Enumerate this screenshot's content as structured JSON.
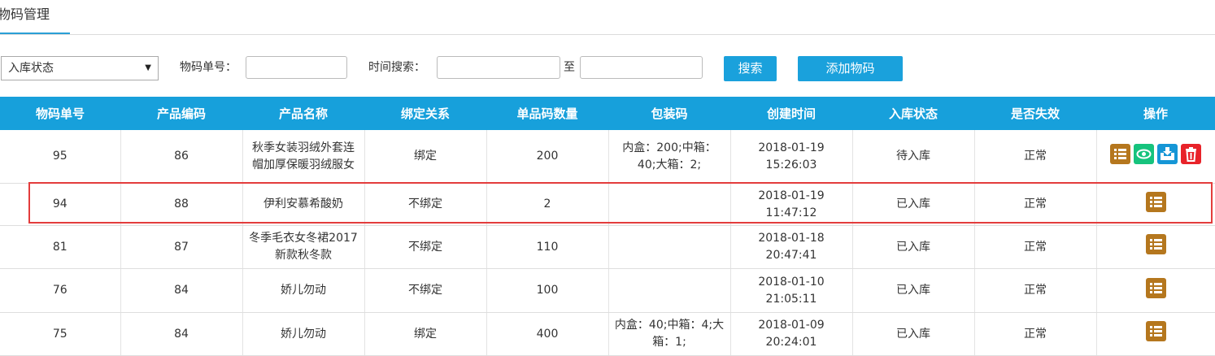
{
  "tab": {
    "label": "物码管理"
  },
  "filters": {
    "status_select": "入库状态",
    "code_label": "物码单号：",
    "time_label": "时间搜索：",
    "to_label": "至",
    "search_button": "搜索",
    "add_button": "添加物码"
  },
  "table": {
    "headers": [
      "物码单号",
      "产品编码",
      "产品名称",
      "绑定关系",
      "单品码数量",
      "包装码",
      "创建时间",
      "入库状态",
      "是否失效",
      "操作"
    ],
    "rows": [
      {
        "code": "95",
        "product_code": "86",
        "name": "秋季女装羽绒外套连帽加厚保暖羽绒服女",
        "bind": "绑定",
        "qty": "200",
        "package": "内盒：200;中箱：40;大箱：2;",
        "time": "2018-01-19 15:26:03",
        "status": "待入库",
        "valid": "正常"
      },
      {
        "code": "94",
        "product_code": "88",
        "name": "伊利安慕希酸奶",
        "bind": "不绑定",
        "qty": "2",
        "package": "",
        "time": "2018-01-19 11:47:12",
        "status": "已入库",
        "valid": "正常"
      },
      {
        "code": "81",
        "product_code": "87",
        "name": "冬季毛衣女冬裙2017新款秋冬款",
        "bind": "不绑定",
        "qty": "110",
        "package": "",
        "time": "2018-01-18 20:47:41",
        "status": "已入库",
        "valid": "正常"
      },
      {
        "code": "76",
        "product_code": "84",
        "name": "娇儿勿动",
        "bind": "不绑定",
        "qty": "100",
        "package": "",
        "time": "2018-01-10 21:05:11",
        "status": "已入库",
        "valid": "正常"
      },
      {
        "code": "75",
        "product_code": "84",
        "name": "娇儿勿动",
        "bind": "绑定",
        "qty": "400",
        "package": "内盒：40;中箱：4;大箱：1;",
        "time": "2018-01-09 20:24:01",
        "status": "已入库",
        "valid": "正常"
      }
    ]
  },
  "icons": {
    "list": "list-icon",
    "view": "eye-icon",
    "save": "save-icon",
    "delete": "trash-icon"
  },
  "colors": {
    "header_bg": "#17a0db",
    "highlight": "#e33c3c"
  }
}
